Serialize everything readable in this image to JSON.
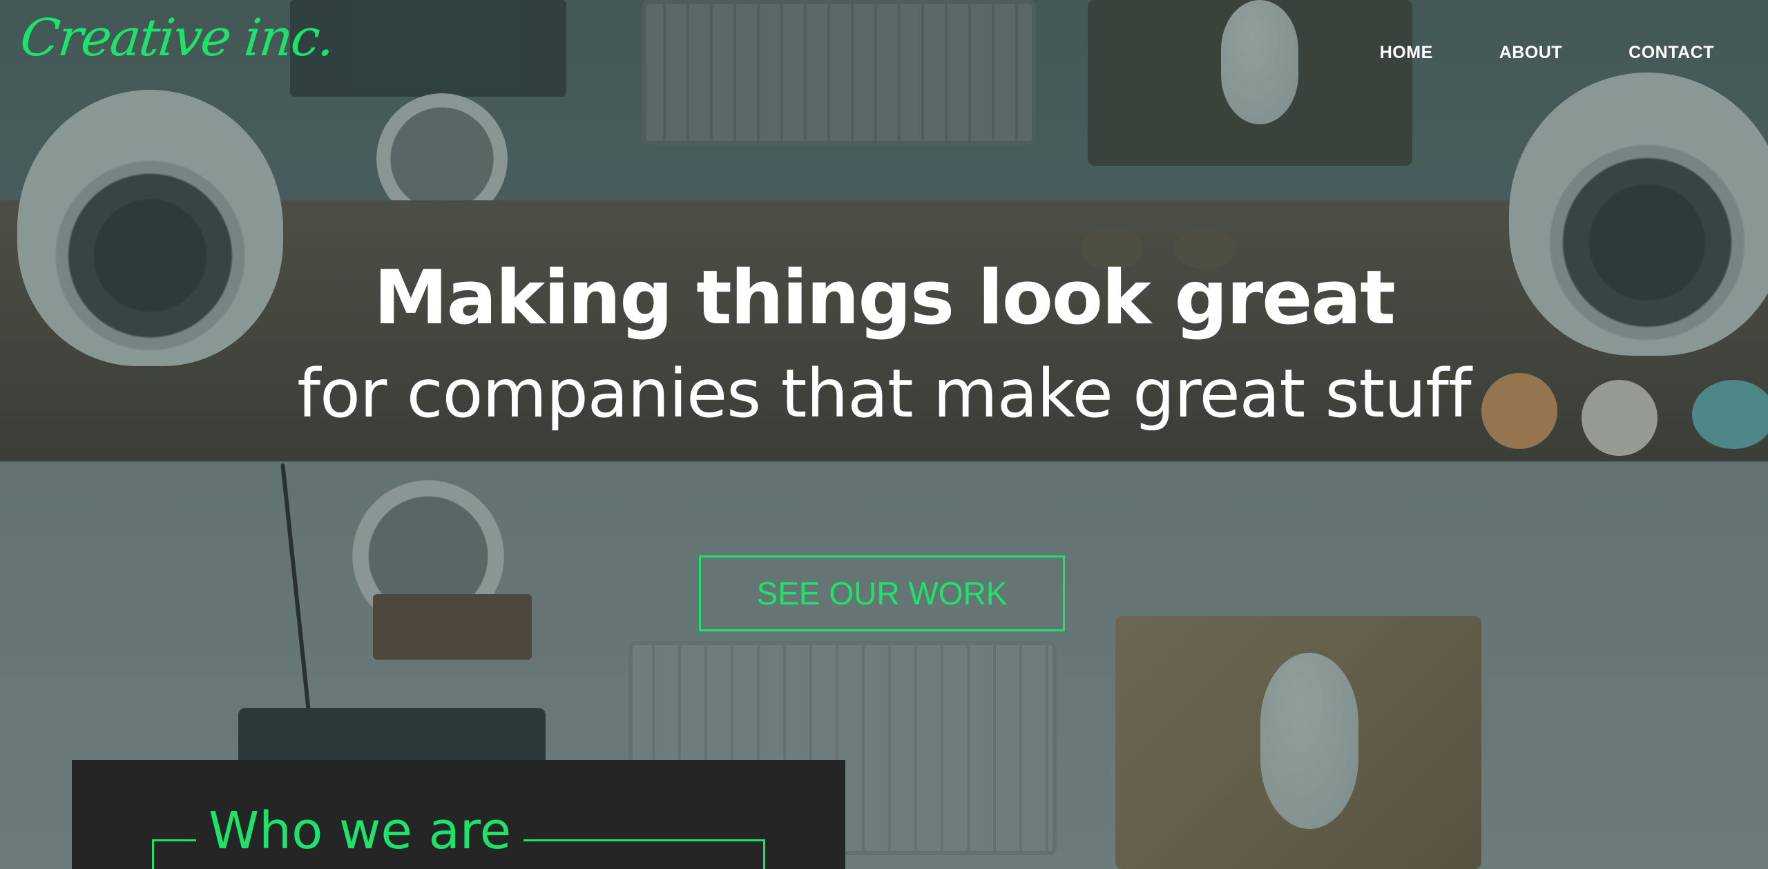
{
  "brand": {
    "logo_text": "Creative inc.",
    "accent_color": "#1ee36a"
  },
  "nav": {
    "items": [
      {
        "label": "HOME"
      },
      {
        "label": "ABOUT"
      },
      {
        "label": "CONTACT"
      }
    ]
  },
  "hero": {
    "title": "Making things look great",
    "subtitle": "for companies that make great stuff",
    "cta_label": "SEE OUR WORK"
  },
  "about_panel": {
    "title": "Who we are"
  }
}
